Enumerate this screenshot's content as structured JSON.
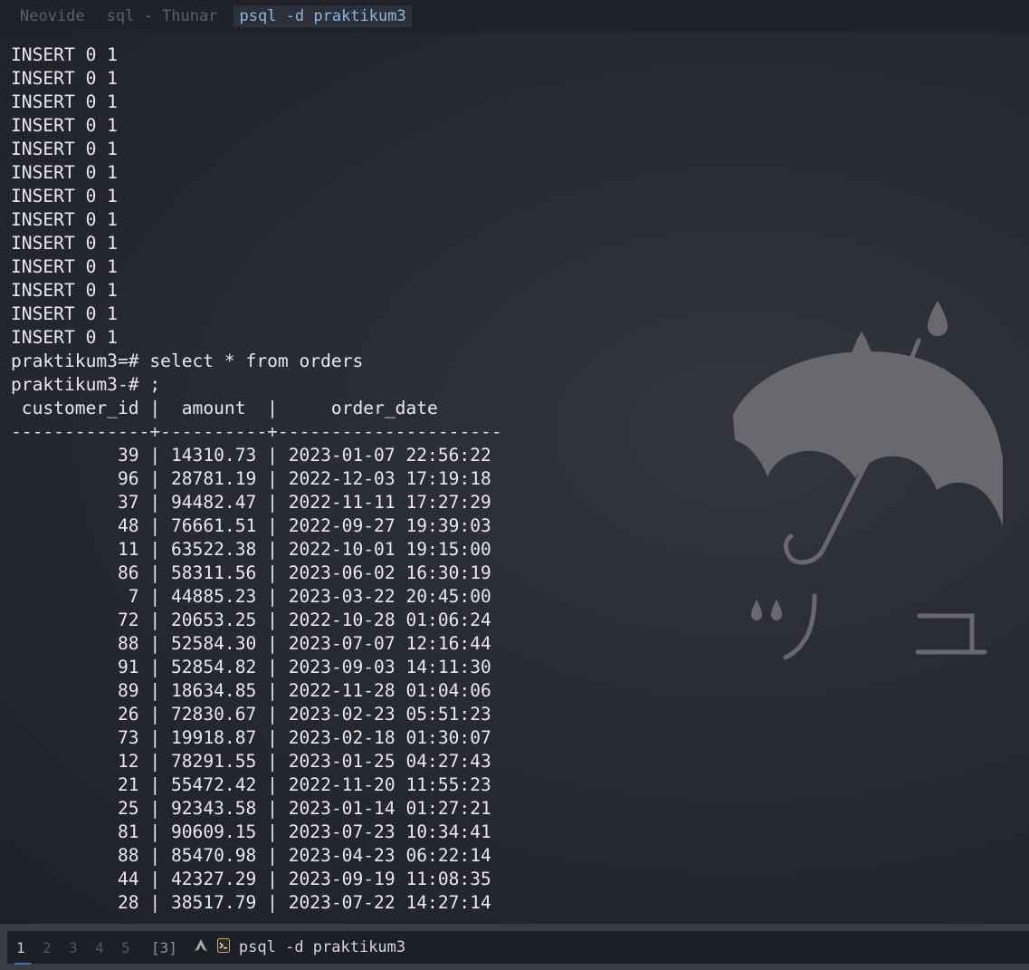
{
  "window_tabs": [
    {
      "label": "Neovide",
      "active": false
    },
    {
      "label": "sql - Thunar",
      "active": false
    },
    {
      "label": "psql -d praktikum3",
      "active": true
    }
  ],
  "terminal": {
    "insert_lines": [
      "INSERT 0 1",
      "INSERT 0 1",
      "INSERT 0 1",
      "INSERT 0 1",
      "INSERT 0 1",
      "INSERT 0 1",
      "INSERT 0 1",
      "INSERT 0 1",
      "INSERT 0 1",
      "INSERT 0 1",
      "INSERT 0 1",
      "INSERT 0 1",
      "INSERT 0 1"
    ],
    "command_line_1": "praktikum3=# select * from orders",
    "command_line_2": "praktikum3-# ;",
    "table_header": " customer_id |  amount  |     order_date",
    "table_divider": "-------------+----------+---------------------",
    "columns": [
      "customer_id",
      "amount",
      "order_date"
    ],
    "rows": [
      {
        "customer_id": "39",
        "amount": "14310.73",
        "order_date": "2023-01-07 22:56:22"
      },
      {
        "customer_id": "96",
        "amount": "28781.19",
        "order_date": "2022-12-03 17:19:18"
      },
      {
        "customer_id": "37",
        "amount": "94482.47",
        "order_date": "2022-11-11 17:27:29"
      },
      {
        "customer_id": "48",
        "amount": "76661.51",
        "order_date": "2022-09-27 19:39:03"
      },
      {
        "customer_id": "11",
        "amount": "63522.38",
        "order_date": "2022-10-01 19:15:00"
      },
      {
        "customer_id": "86",
        "amount": "58311.56",
        "order_date": "2023-06-02 16:30:19"
      },
      {
        "customer_id": "7",
        "amount": "44885.23",
        "order_date": "2023-03-22 20:45:00"
      },
      {
        "customer_id": "72",
        "amount": "20653.25",
        "order_date": "2022-10-28 01:06:24"
      },
      {
        "customer_id": "88",
        "amount": "52584.30",
        "order_date": "2023-07-07 12:16:44"
      },
      {
        "customer_id": "91",
        "amount": "52854.82",
        "order_date": "2023-09-03 14:11:30"
      },
      {
        "customer_id": "89",
        "amount": "18634.85",
        "order_date": "2022-11-28 01:04:06"
      },
      {
        "customer_id": "26",
        "amount": "72830.67",
        "order_date": "2023-02-23 05:51:23"
      },
      {
        "customer_id": "73",
        "amount": "19918.87",
        "order_date": "2023-02-18 01:30:07"
      },
      {
        "customer_id": "12",
        "amount": "78291.55",
        "order_date": "2023-01-25 04:27:43"
      },
      {
        "customer_id": "21",
        "amount": "55472.42",
        "order_date": "2022-11-20 11:55:23"
      },
      {
        "customer_id": "25",
        "amount": "92343.58",
        "order_date": "2023-01-14 01:27:21"
      },
      {
        "customer_id": "81",
        "amount": "90609.15",
        "order_date": "2023-07-23 10:34:41"
      },
      {
        "customer_id": "88",
        "amount": "85470.98",
        "order_date": "2023-04-23 06:22:14"
      },
      {
        "customer_id": "44",
        "amount": "42327.29",
        "order_date": "2023-09-19 11:08:35"
      },
      {
        "customer_id": "28",
        "amount": "38517.79",
        "order_date": "2023-07-22 14:27:14"
      }
    ]
  },
  "wallpaper": {
    "icon": "umbrella-rain-icon",
    "text_left": "ツ",
    "text_right": "ユ",
    "color": "#6b6d72"
  },
  "statusbar": {
    "workspaces": [
      {
        "label": "1",
        "active": true
      },
      {
        "label": "2",
        "active": false
      },
      {
        "label": "3",
        "active": false
      },
      {
        "label": "4",
        "active": false
      },
      {
        "label": "5",
        "active": false
      }
    ],
    "layout_indicator": "[3]",
    "launcher_icon": "arch-logo-icon",
    "app_icon": "terminal-icon",
    "window_title": "psql -d praktikum3"
  },
  "colors": {
    "terminal_text": "#e8e9ec",
    "active_tab_text": "#8fb4e0",
    "workspace_active_underline": "#3b74c9"
  }
}
